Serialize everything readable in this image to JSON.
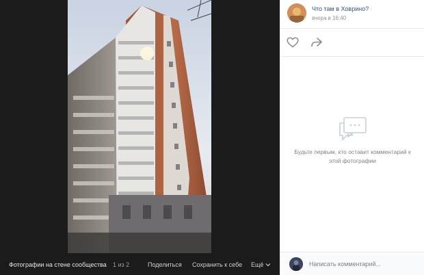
{
  "viewer": {
    "album_title": "Фотографии на стене сообщества",
    "counter": "1 из 2",
    "share_label": "Поделиться",
    "save_label": "Сохранить к себе",
    "more_label": "Ещё"
  },
  "post": {
    "community_name": "Что там в Ховрино?",
    "date": "вчера в 16:40"
  },
  "comments": {
    "empty_text": "Будьте первым, кто оставит комментарий к этой фотографии",
    "input_placeholder": "Написать комментарий..."
  },
  "icons": {
    "like": "heart-icon",
    "share": "share-arrow-icon",
    "empty_comments": "speech-bubbles-icon",
    "more": "chevron-down-icon"
  },
  "colors": {
    "link": "#2a5885",
    "viewer_bg": "#1b1b1b",
    "muted": "#828282",
    "icon": "#818c99"
  }
}
